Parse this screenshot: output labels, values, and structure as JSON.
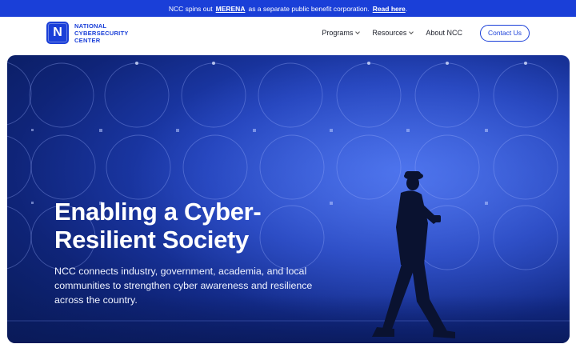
{
  "announcement": {
    "prefix": "NCC spins out",
    "brand": "MERENA",
    "suffix": "as a separate public benefit corporation.",
    "link": "Read here",
    "end": "."
  },
  "logo": {
    "letter": "N",
    "line1": "NATIONAL",
    "line2": "CYBERSECURITY",
    "line3": "CENTER"
  },
  "nav": {
    "programs": "Programs",
    "resources": "Resources",
    "about": "About NCC",
    "contact": "Contact Us"
  },
  "hero": {
    "title": "Enabling a Cyber-Resilient Society",
    "description": "NCC connects industry, government, academia, and local communities to strengthen cyber awareness and resilience across the country."
  },
  "colors": {
    "accent": "#1a3fd8",
    "hero_dark": "#0f2478",
    "hero_light": "#3a63e0"
  }
}
